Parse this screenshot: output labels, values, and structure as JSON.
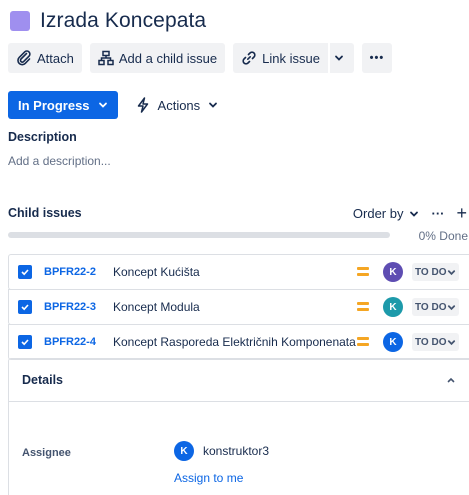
{
  "issue": {
    "title": "Izrada Koncepata",
    "type_icon": "story-square-icon",
    "type_color": "#9f8fef"
  },
  "toolbar": {
    "attach_label": "Attach",
    "add_child_label": "Add a child issue",
    "link_issue_label": "Link issue",
    "more_label": "•••"
  },
  "status": {
    "label": "In Progress",
    "color": "#0c66e4",
    "actions_label": "Actions"
  },
  "description": {
    "heading": "Description",
    "placeholder": "Add a description..."
  },
  "child_issues": {
    "heading": "Child issues",
    "order_by_label": "Order by",
    "more_label": "···",
    "add_label": "+",
    "progress_percent": 0,
    "progress_label": "0% Done",
    "items": [
      {
        "key": "BPFR22-2",
        "summary": "Koncept Kućišta",
        "priority": "medium",
        "assignee_initial": "K",
        "assignee_color": "#5e4db2",
        "status": "TO DO"
      },
      {
        "key": "BPFR22-3",
        "summary": "Koncept Modula",
        "priority": "medium",
        "assignee_initial": "K",
        "assignee_color": "#1d9aaa",
        "status": "TO DO"
      },
      {
        "key": "BPFR22-4",
        "summary": "Koncept Rasporeda Električnih Komponenata",
        "priority": "medium",
        "assignee_initial": "K",
        "assignee_color": "#0c66e4",
        "status": "TO DO"
      }
    ]
  },
  "details": {
    "heading": "Details",
    "assignee_label": "Assignee",
    "assignee_initial": "K",
    "assignee_name": "konstruktor3",
    "assign_to_me_label": "Assign to me"
  }
}
